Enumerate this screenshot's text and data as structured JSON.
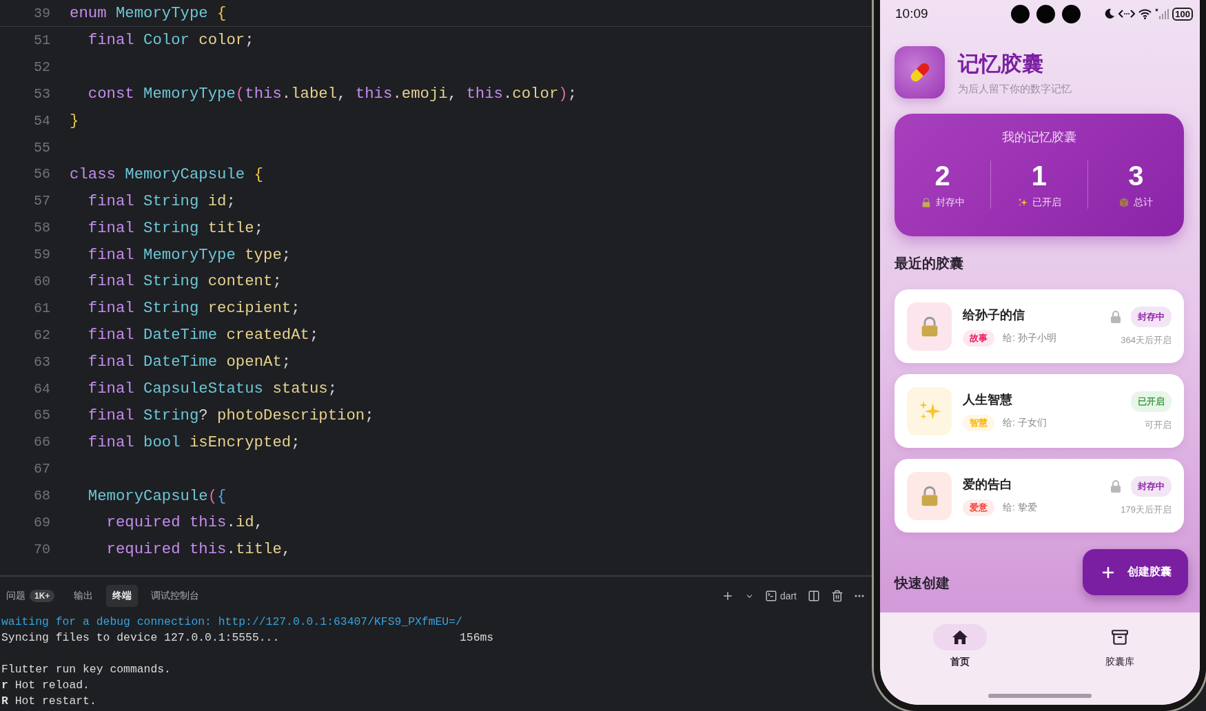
{
  "editor": {
    "sticky_line": {
      "number": "39",
      "tokens": [
        {
          "t": "enum ",
          "kind": "keyword"
        },
        {
          "t": "MemoryType ",
          "kind": "type"
        },
        {
          "t": "{",
          "kind": "bracket1"
        }
      ]
    },
    "lines": [
      {
        "number": "51",
        "tokens": [
          {
            "t": "  final ",
            "kind": "keyword"
          },
          {
            "t": "Color ",
            "kind": "type"
          },
          {
            "t": "color",
            "kind": "name"
          },
          {
            "t": ";",
            "kind": "plain"
          }
        ]
      },
      {
        "number": "52"
      },
      {
        "number": "53",
        "tokens": [
          {
            "t": "  const ",
            "kind": "keyword"
          },
          {
            "t": "MemoryType",
            "kind": "type"
          },
          {
            "t": "(",
            "kind": "bracket2"
          },
          {
            "t": "this",
            "kind": "keyword"
          },
          {
            "t": ".",
            "kind": "plain"
          },
          {
            "t": "label",
            "kind": "name"
          },
          {
            "t": ", ",
            "kind": "plain"
          },
          {
            "t": "this",
            "kind": "keyword"
          },
          {
            "t": ".",
            "kind": "plain"
          },
          {
            "t": "emoji",
            "kind": "name"
          },
          {
            "t": ", ",
            "kind": "plain"
          },
          {
            "t": "this",
            "kind": "keyword"
          },
          {
            "t": ".",
            "kind": "plain"
          },
          {
            "t": "color",
            "kind": "name"
          },
          {
            "t": ")",
            "kind": "bracket2"
          },
          {
            "t": ";",
            "kind": "plain"
          }
        ]
      },
      {
        "number": "54",
        "tokens": [
          {
            "t": "}",
            "kind": "bracket1"
          }
        ]
      },
      {
        "number": "55"
      },
      {
        "number": "56",
        "tokens": [
          {
            "t": "class ",
            "kind": "keyword"
          },
          {
            "t": "MemoryCapsule ",
            "kind": "type"
          },
          {
            "t": "{",
            "kind": "bracket1"
          }
        ]
      },
      {
        "number": "57",
        "tokens": [
          {
            "t": "  final ",
            "kind": "keyword"
          },
          {
            "t": "String ",
            "kind": "type"
          },
          {
            "t": "id",
            "kind": "name"
          },
          {
            "t": ";",
            "kind": "plain"
          }
        ]
      },
      {
        "number": "58",
        "tokens": [
          {
            "t": "  final ",
            "kind": "keyword"
          },
          {
            "t": "String ",
            "kind": "type"
          },
          {
            "t": "title",
            "kind": "name"
          },
          {
            "t": ";",
            "kind": "plain"
          }
        ]
      },
      {
        "number": "59",
        "tokens": [
          {
            "t": "  final ",
            "kind": "keyword"
          },
          {
            "t": "MemoryType ",
            "kind": "type"
          },
          {
            "t": "type",
            "kind": "name"
          },
          {
            "t": ";",
            "kind": "plain"
          }
        ]
      },
      {
        "number": "60",
        "tokens": [
          {
            "t": "  final ",
            "kind": "keyword"
          },
          {
            "t": "String ",
            "kind": "type"
          },
          {
            "t": "content",
            "kind": "name"
          },
          {
            "t": ";",
            "kind": "plain"
          }
        ]
      },
      {
        "number": "61",
        "tokens": [
          {
            "t": "  final ",
            "kind": "keyword"
          },
          {
            "t": "String ",
            "kind": "type"
          },
          {
            "t": "recipient",
            "kind": "name"
          },
          {
            "t": ";",
            "kind": "plain"
          }
        ]
      },
      {
        "number": "62",
        "tokens": [
          {
            "t": "  final ",
            "kind": "keyword"
          },
          {
            "t": "DateTime ",
            "kind": "type"
          },
          {
            "t": "createdAt",
            "kind": "name"
          },
          {
            "t": ";",
            "kind": "plain"
          }
        ]
      },
      {
        "number": "63",
        "tokens": [
          {
            "t": "  final ",
            "kind": "keyword"
          },
          {
            "t": "DateTime ",
            "kind": "type"
          },
          {
            "t": "openAt",
            "kind": "name"
          },
          {
            "t": ";",
            "kind": "plain"
          }
        ]
      },
      {
        "number": "64",
        "tokens": [
          {
            "t": "  final ",
            "kind": "keyword"
          },
          {
            "t": "CapsuleStatus ",
            "kind": "type"
          },
          {
            "t": "status",
            "kind": "name"
          },
          {
            "t": ";",
            "kind": "plain"
          }
        ]
      },
      {
        "number": "65",
        "tokens": [
          {
            "t": "  final ",
            "kind": "keyword"
          },
          {
            "t": "String",
            "kind": "type"
          },
          {
            "t": "? ",
            "kind": "plain"
          },
          {
            "t": "photoDescription",
            "kind": "name"
          },
          {
            "t": ";",
            "kind": "plain"
          }
        ]
      },
      {
        "number": "66",
        "tokens": [
          {
            "t": "  final ",
            "kind": "keyword"
          },
          {
            "t": "bool ",
            "kind": "type"
          },
          {
            "t": "isEncrypted",
            "kind": "name"
          },
          {
            "t": ";",
            "kind": "plain"
          }
        ]
      },
      {
        "number": "67"
      },
      {
        "number": "68",
        "tokens": [
          {
            "t": "  MemoryCapsule",
            "kind": "type"
          },
          {
            "t": "(",
            "kind": "bracket2"
          },
          {
            "t": "{",
            "kind": "bracket3"
          }
        ]
      },
      {
        "number": "69",
        "tokens": [
          {
            "t": "    required ",
            "kind": "keyword"
          },
          {
            "t": "this",
            "kind": "keyword"
          },
          {
            "t": ".",
            "kind": "plain"
          },
          {
            "t": "id",
            "kind": "name"
          },
          {
            "t": ",",
            "kind": "plain"
          }
        ]
      },
      {
        "number": "70",
        "tokens": [
          {
            "t": "    required ",
            "kind": "keyword"
          },
          {
            "t": "this",
            "kind": "keyword"
          },
          {
            "t": ".",
            "kind": "plain"
          },
          {
            "t": "title",
            "kind": "name"
          },
          {
            "t": ",",
            "kind": "plain"
          }
        ]
      }
    ]
  },
  "panel": {
    "tabs": [
      {
        "label": "问题",
        "badge": "1K+",
        "selected": false
      },
      {
        "label": "输出",
        "selected": false
      },
      {
        "label": "终端",
        "selected": true
      },
      {
        "label": "调试控制台",
        "selected": false
      }
    ],
    "shell": "dart",
    "terminal": [
      {
        "kind": "link",
        "text": "waiting for a debug connection: http://127.0.0.1:63407/KFS9_PXfmEU=/"
      },
      {
        "kind": "timed",
        "text": "Syncing files to device 127.0.0.1:5555...",
        "time": "156ms"
      },
      {
        "kind": "blank"
      },
      {
        "kind": "plain",
        "text": "Flutter run key commands."
      },
      {
        "kind": "key",
        "key": "r",
        "text": "Hot reload."
      },
      {
        "kind": "key",
        "key": "R",
        "text": "Hot restart."
      }
    ]
  },
  "phone": {
    "status_bar": {
      "time": "10:09",
      "battery": "100"
    },
    "app": {
      "title": "记忆胶囊",
      "subtitle": "为后人留下你的数字记忆"
    },
    "stats": {
      "title": "我的记忆胶囊",
      "items": [
        {
          "kind": "sealed",
          "value": "2",
          "label": "封存中"
        },
        {
          "kind": "opened",
          "value": "1",
          "label": "已开启"
        },
        {
          "kind": "total",
          "value": "3",
          "label": "总计"
        }
      ]
    },
    "recent": {
      "title": "最近的胶囊",
      "capsules": [
        {
          "kind": "sealed",
          "title": "给孙子的信",
          "tag": "故事",
          "color": "#e91e63",
          "recipient": "给: 孙子小明",
          "status": "封存中",
          "note": "364天后开启"
        },
        {
          "kind": "opened",
          "title": "人生智慧",
          "tag": "智慧",
          "color": "#ffb300",
          "recipient": "给: 子女们",
          "status": "已开启",
          "note": "可开启"
        },
        {
          "kind": "sealed",
          "title": "爱的告白",
          "tag": "爱意",
          "color": "#f44336",
          "recipient": "给: 挚爱",
          "status": "封存中",
          "note": "179天后开启"
        }
      ]
    },
    "quick_create": {
      "title": "快速创建"
    },
    "create_button": {
      "label": "创建胶囊"
    },
    "nav": [
      {
        "kind": "home",
        "label": "首页",
        "selected": true
      },
      {
        "kind": "archive",
        "label": "胶囊库",
        "selected": false
      }
    ]
  }
}
